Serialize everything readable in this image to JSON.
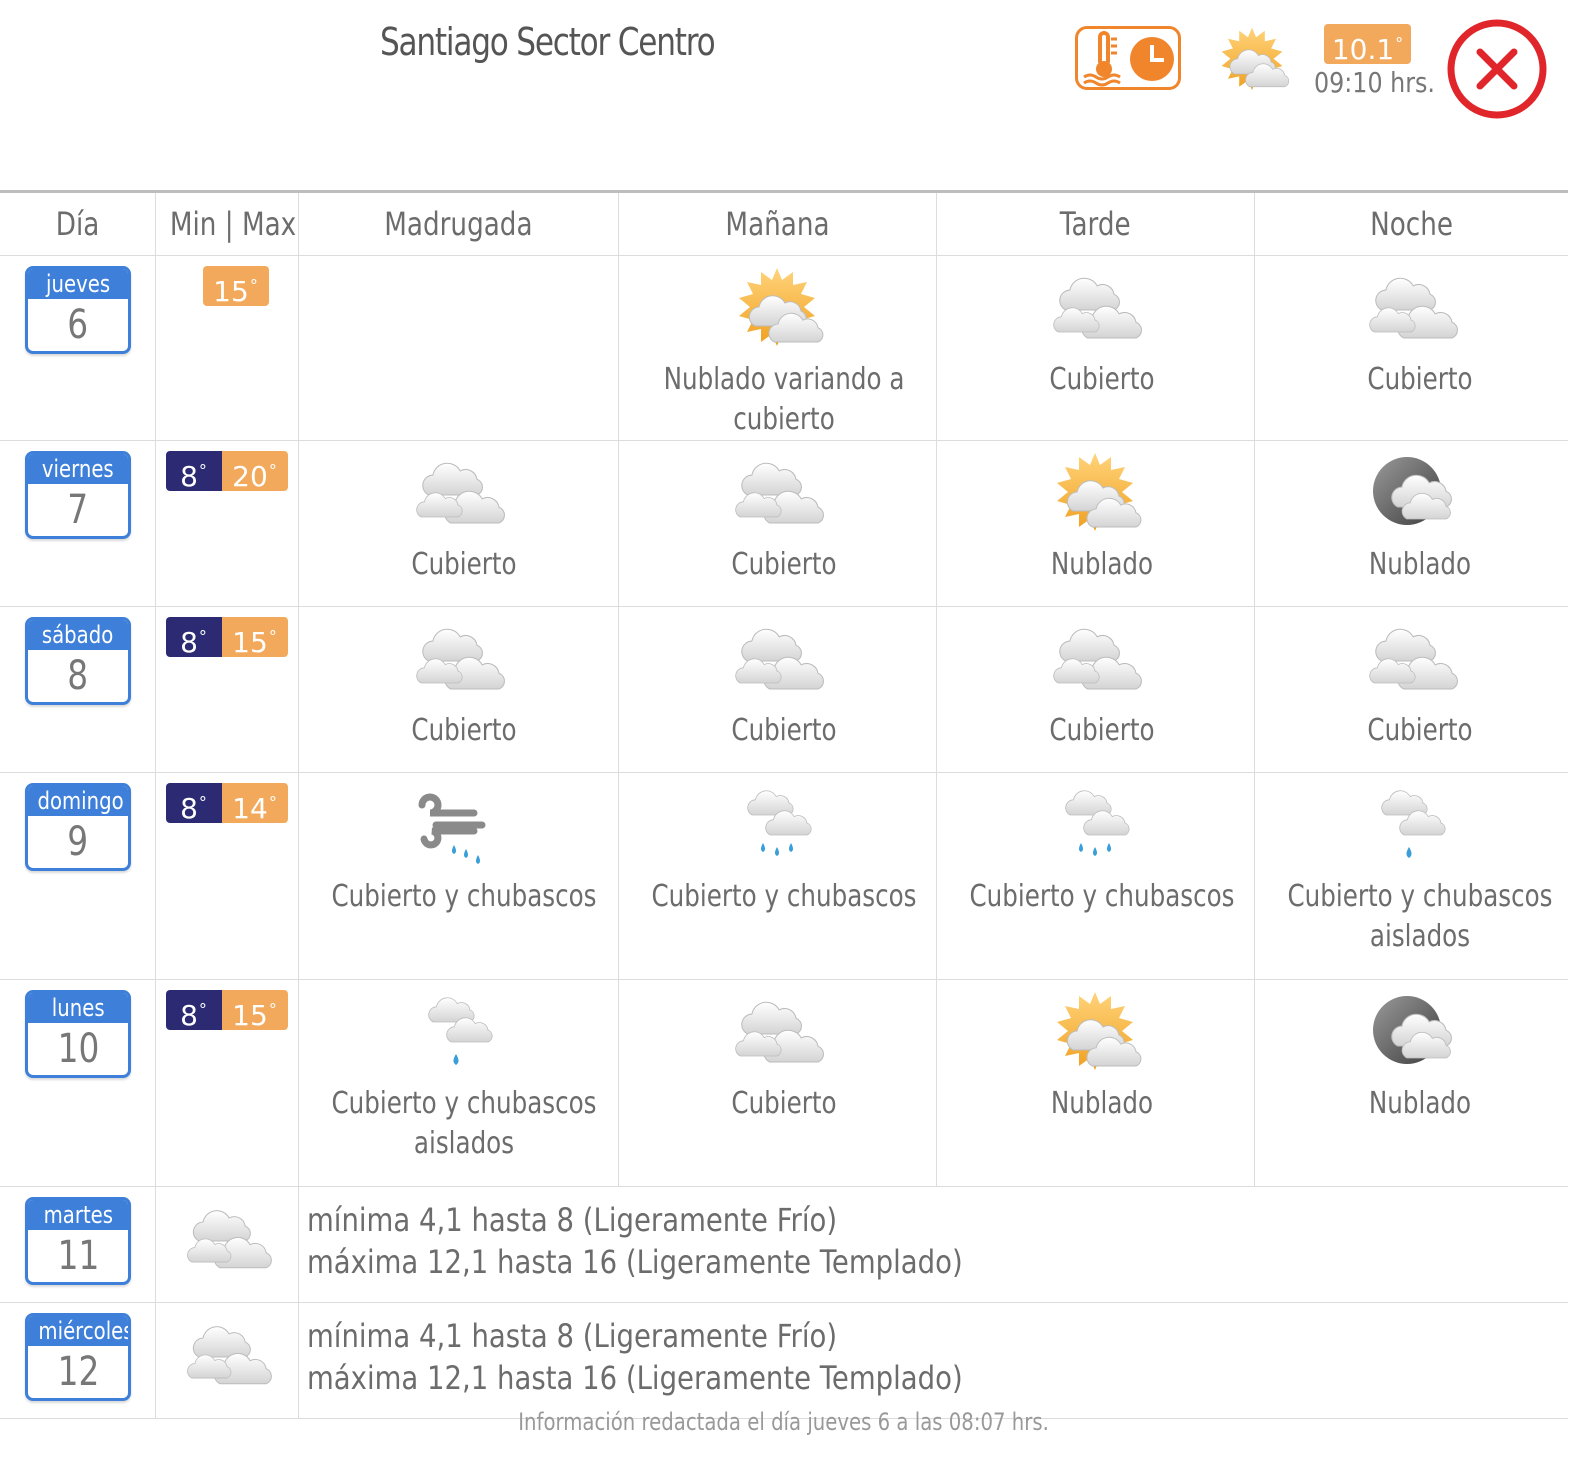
{
  "header": {
    "location": "Santiago Sector Centro",
    "current_temp": "10.1",
    "current_time": "09:10 hrs.",
    "current_icon": "partly-cloudy-sun-icon",
    "thermo_button_icon": "thermometer-clock-icon",
    "close_icon": "close-icon"
  },
  "columns": [
    "Día",
    "Min | Max",
    "Madrugada",
    "Mañana",
    "Tarde",
    "Noche"
  ],
  "days": [
    {
      "name": "jueves",
      "num": "6",
      "min": "",
      "max": "15",
      "periods": [
        {
          "icon": "",
          "desc": ""
        },
        {
          "icon": "sun-cloud-icon",
          "desc": "Nublado variando a cubierto"
        },
        {
          "icon": "overcast-icon",
          "desc": "Cubierto"
        },
        {
          "icon": "overcast-icon",
          "desc": "Cubierto"
        }
      ]
    },
    {
      "name": "viernes",
      "num": "7",
      "min": "8",
      "max": "20",
      "periods": [
        {
          "icon": "overcast-icon",
          "desc": "Cubierto"
        },
        {
          "icon": "overcast-icon",
          "desc": "Cubierto"
        },
        {
          "icon": "sun-cloud-icon",
          "desc": "Nublado"
        },
        {
          "icon": "moon-cloud-icon",
          "desc": "Nublado"
        }
      ]
    },
    {
      "name": "sábado",
      "num": "8",
      "min": "8",
      "max": "15",
      "periods": [
        {
          "icon": "overcast-icon",
          "desc": "Cubierto"
        },
        {
          "icon": "overcast-icon",
          "desc": "Cubierto"
        },
        {
          "icon": "overcast-icon",
          "desc": "Cubierto"
        },
        {
          "icon": "overcast-icon",
          "desc": "Cubierto"
        }
      ]
    },
    {
      "name": "domingo",
      "num": "9",
      "min": "8",
      "max": "14",
      "periods": [
        {
          "icon": "wind-rain-icon",
          "desc": "Cubierto y chubascos"
        },
        {
          "icon": "cloud-rain-icon",
          "desc": "Cubierto y chubascos"
        },
        {
          "icon": "cloud-rain-icon",
          "desc": "Cubierto y chubascos"
        },
        {
          "icon": "cloud-drop-icon",
          "desc": "Cubierto y chubascos aislados"
        }
      ]
    },
    {
      "name": "lunes",
      "num": "10",
      "min": "8",
      "max": "15",
      "periods": [
        {
          "icon": "cloud-drop-icon",
          "desc": "Cubierto y chubascos aislados"
        },
        {
          "icon": "overcast-icon",
          "desc": "Cubierto"
        },
        {
          "icon": "sun-cloud-icon",
          "desc": "Nublado"
        },
        {
          "icon": "moon-cloud-icon",
          "desc": "Nublado"
        }
      ]
    }
  ],
  "extended": [
    {
      "name": "martes",
      "num": "11",
      "icon": "overcast-icon",
      "min_text": "mínima 4,1 hasta 8 (Ligeramente Frío)",
      "max_text": "máxima 12,1 hasta 16 (Ligeramente Templado)"
    },
    {
      "name": "miércoles",
      "num": "12",
      "icon": "overcast-icon",
      "min_text": "mínima 4,1 hasta 8 (Ligeramente Frío)",
      "max_text": "máxima 12,1 hasta 16 (Ligeramente Templado)"
    }
  ],
  "footer": "Información redactada el día jueves 6 a las 08:07 hrs.",
  "colors": {
    "day_blue": "#3d7fd9",
    "min_navy": "#2b2a73",
    "max_orange": "#f2a95c",
    "close_red": "#e0262a",
    "accent_orange": "#f0852c"
  }
}
